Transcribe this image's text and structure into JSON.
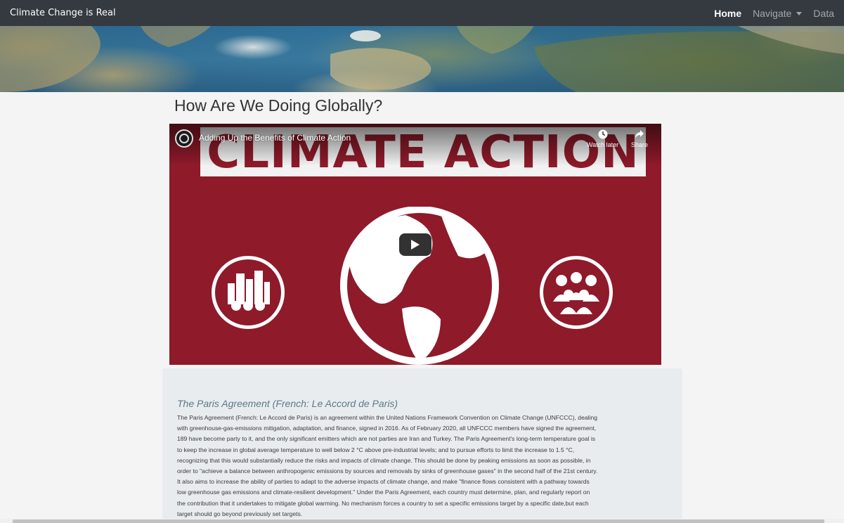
{
  "navbar": {
    "brand": "Climate Change is Real",
    "links": [
      {
        "label": "Home",
        "active": true
      },
      {
        "label": "Navigate",
        "dropdown": true
      },
      {
        "label": "Data"
      }
    ]
  },
  "main": {
    "title": "How Are We Doing Globally?"
  },
  "video": {
    "title": "Adding Up the Benefits of Climate Action",
    "thumbnail_text": "CLIMATE ACTION",
    "watch_later_label": "Watch later",
    "share_label": "Share",
    "colors": {
      "background": "#8e1a2a",
      "banner": "#f2f2f2"
    }
  },
  "info": {
    "heading": "The Paris Agreement (French: Le Accord de Paris)",
    "lines": [
      "The Paris Agreement (French: Le Accord de Paris) is an agreement within the United Nations Framework Convention on Climate Change (UNFCCC), dealing",
      "with greenhouse-gas-emissions mitigation, adaptation, and finance, signed in 2016. As of February 2020, all UNFCCC members have signed the agreement,",
      "189 have become party to it, and the only significant emitters which are not parties are Iran and Turkey. The Paris Agreement's long-term temperature goal is",
      "to keep the increase in global average temperature to well below 2 °C above pre-industrial levels; and to pursue efforts to limit the increase to 1.5 °C,",
      "recognizing that this would substantially reduce the risks and impacts of climate change. This should be done by peaking emissions as soon as possible, in",
      "order to \"achieve a balance between anthropogenic emissions by sources and removals by sinks of greenhouse gases\" in the second half of the 21st century.",
      "It also aims to increase the ability of parties to adapt to the adverse impacts of climate change, and make \"finance flows consistent with a pathway towards",
      "low greenhouse gas emissions and climate-resilient development.\" Under the Paris Agreement, each country must determine, plan, and regularly report on",
      "the contribution that it undertakes to mitigate global warming. No mechanism forces a country to set a specific emissions target by a specific date,but each",
      "target should go beyond previously set targets."
    ]
  }
}
